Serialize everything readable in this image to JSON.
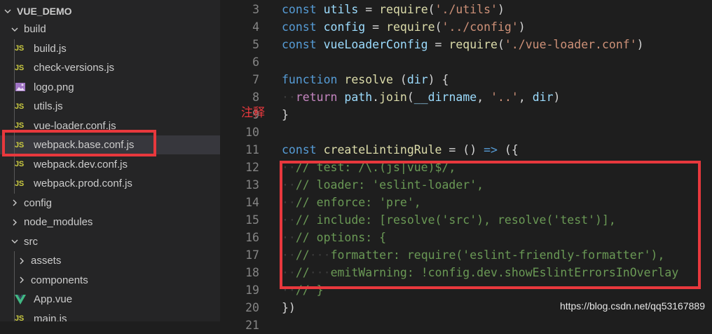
{
  "explorer": {
    "root": "VUE_DEMO",
    "items": [
      {
        "label": "build",
        "kind": "folder-open"
      },
      {
        "label": "build.js",
        "kind": "js"
      },
      {
        "label": "check-versions.js",
        "kind": "js"
      },
      {
        "label": "logo.png",
        "kind": "image"
      },
      {
        "label": "utils.js",
        "kind": "js"
      },
      {
        "label": "vue-loader.conf.js",
        "kind": "js"
      },
      {
        "label": "webpack.base.conf.js",
        "kind": "js",
        "selected": true
      },
      {
        "label": "webpack.dev.conf.js",
        "kind": "js"
      },
      {
        "label": "webpack.prod.conf.js",
        "kind": "js"
      },
      {
        "label": "config",
        "kind": "folder-closed"
      },
      {
        "label": "node_modules",
        "kind": "folder-closed"
      },
      {
        "label": "src",
        "kind": "folder-open"
      },
      {
        "label": "assets",
        "kind": "folder-closed"
      },
      {
        "label": "components",
        "kind": "folder-closed"
      },
      {
        "label": "App.vue",
        "kind": "vue"
      },
      {
        "label": "main.js",
        "kind": "js"
      }
    ],
    "js_badge": "JS"
  },
  "editor": {
    "lines": [
      {
        "n": "3",
        "tokens": [
          [
            "kw",
            "const"
          ],
          [
            "t",
            " "
          ],
          [
            "var",
            "utils"
          ],
          [
            "t",
            " = "
          ],
          [
            "fn",
            "require"
          ],
          [
            "t",
            "("
          ],
          [
            "str",
            "'./utils'"
          ],
          [
            "t",
            ")"
          ]
        ]
      },
      {
        "n": "4",
        "tokens": [
          [
            "kw",
            "const"
          ],
          [
            "t",
            " "
          ],
          [
            "var",
            "config"
          ],
          [
            "t",
            " = "
          ],
          [
            "fn",
            "require"
          ],
          [
            "t",
            "("
          ],
          [
            "str",
            "'../config'"
          ],
          [
            "t",
            ")"
          ]
        ]
      },
      {
        "n": "5",
        "tokens": [
          [
            "kw",
            "const"
          ],
          [
            "t",
            " "
          ],
          [
            "var",
            "vueLoaderConfig"
          ],
          [
            "t",
            " = "
          ],
          [
            "fn",
            "require"
          ],
          [
            "t",
            "("
          ],
          [
            "str",
            "'./vue-loader.conf'"
          ],
          [
            "t",
            ")"
          ]
        ]
      },
      {
        "n": "6",
        "tokens": []
      },
      {
        "n": "7",
        "tokens": [
          [
            "kw",
            "function"
          ],
          [
            "t",
            " "
          ],
          [
            "fn",
            "resolve"
          ],
          [
            "t",
            " ("
          ],
          [
            "var",
            "dir"
          ],
          [
            "t",
            ") {"
          ]
        ]
      },
      {
        "n": "8",
        "tokens": [
          [
            "ws",
            "··"
          ],
          [
            "kwc",
            "return"
          ],
          [
            "t",
            " "
          ],
          [
            "var",
            "path"
          ],
          [
            "t",
            "."
          ],
          [
            "fn",
            "join"
          ],
          [
            "t",
            "("
          ],
          [
            "var",
            "__dirname"
          ],
          [
            "t",
            ", "
          ],
          [
            "str",
            "'..'"
          ],
          [
            "t",
            ", "
          ],
          [
            "var",
            "dir"
          ],
          [
            "t",
            ")"
          ]
        ]
      },
      {
        "n": "9",
        "tokens": [
          [
            "t",
            "}"
          ]
        ]
      },
      {
        "n": "10",
        "tokens": []
      },
      {
        "n": "11",
        "tokens": [
          [
            "kw",
            "const"
          ],
          [
            "t",
            " "
          ],
          [
            "fn",
            "createLintingRule"
          ],
          [
            "t",
            " = () "
          ],
          [
            "kw",
            "=>"
          ],
          [
            "t",
            " ({"
          ]
        ]
      },
      {
        "n": "12",
        "tokens": [
          [
            "ws",
            "··"
          ],
          [
            "cmt",
            "// test: /\\.(js|vue)$/,"
          ]
        ]
      },
      {
        "n": "13",
        "tokens": [
          [
            "ws",
            "··"
          ],
          [
            "cmt",
            "// loader: 'eslint-loader',"
          ]
        ]
      },
      {
        "n": "14",
        "tokens": [
          [
            "ws",
            "··"
          ],
          [
            "cmt",
            "// enforce: 'pre',"
          ]
        ]
      },
      {
        "n": "15",
        "tokens": [
          [
            "ws",
            "··"
          ],
          [
            "cmt",
            "// include: [resolve('src'), resolve('test')],"
          ]
        ]
      },
      {
        "n": "16",
        "tokens": [
          [
            "ws",
            "··"
          ],
          [
            "cmt",
            "// options: {"
          ]
        ]
      },
      {
        "n": "17",
        "tokens": [
          [
            "ws",
            "··"
          ],
          [
            "cmt",
            "//"
          ],
          [
            "ws",
            "···"
          ],
          [
            "cmt",
            "formatter: require('eslint-friendly-formatter'),"
          ]
        ]
      },
      {
        "n": "18",
        "tokens": [
          [
            "ws",
            "··"
          ],
          [
            "cmt",
            "//"
          ],
          [
            "ws",
            "···"
          ],
          [
            "cmt",
            "emitWarning: !config.dev.showEslintErrorsInOverlay"
          ]
        ]
      },
      {
        "n": "19",
        "tokens": [
          [
            "ws",
            "··"
          ],
          [
            "cmt",
            "// }"
          ]
        ]
      },
      {
        "n": "20",
        "tokens": [
          [
            "t",
            "})"
          ]
        ]
      },
      {
        "n": "21",
        "tokens": []
      }
    ]
  },
  "annotation": "注释",
  "watermark": "https://blog.csdn.net/qq53167889",
  "colors": {
    "highlight_box": "#e8383d",
    "js_icon": "#cbcb41"
  }
}
